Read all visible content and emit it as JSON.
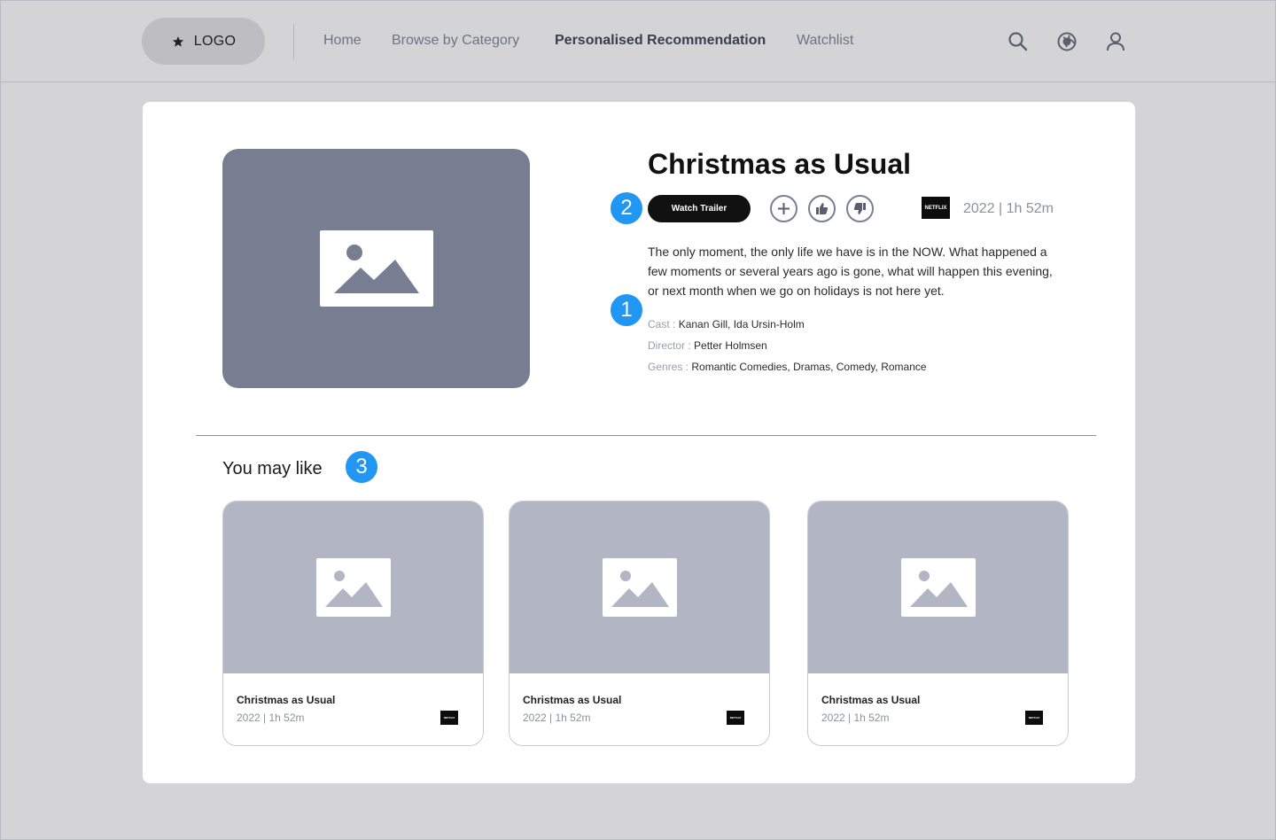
{
  "header": {
    "logo_text": "LOGO",
    "nav": [
      {
        "label": "Home",
        "active": false
      },
      {
        "label": "Browse by Category",
        "active": false
      },
      {
        "label": "Personalised Recommendation",
        "active": true
      },
      {
        "label": "Watchlist",
        "active": false
      }
    ],
    "icons": [
      "search-icon",
      "globe-icon",
      "user-icon"
    ]
  },
  "detail": {
    "title": "Christmas as Usual",
    "trailer_label": "Watch Trailer",
    "actions": [
      "add-icon",
      "thumbs-up-icon",
      "thumbs-down-icon"
    ],
    "provider": "NETFLIX",
    "meta": "2022 | 1h 52m",
    "description": "The only moment, the only life we have is in the NOW. What happened a few moments or several years ago is gone, what will happen this evening, or next month when we go on holidays is not here yet.",
    "cast_label": "Cast : ",
    "cast": "Kanan Gill, Ida Ursin-Holm",
    "director_label": "Director : ",
    "director": "Petter Holmsen",
    "genres_label": "Genres : ",
    "genres": "Romantic Comedies, Dramas, Comedy, Romance"
  },
  "badges": [
    "1",
    "2",
    "3"
  ],
  "recommendations": {
    "heading": "You may like",
    "items": [
      {
        "title": "Christmas as Usual",
        "meta": "2022 | 1h 52m",
        "provider": "NETFLIX"
      },
      {
        "title": "Christmas as Usual",
        "meta": "2022 | 1h 52m",
        "provider": "NETFLIX"
      },
      {
        "title": "Christmas as Usual",
        "meta": "2022 | 1h 52m",
        "provider": "NETFLIX"
      }
    ]
  },
  "colors": {
    "badge": "#2196f3",
    "background": "#d4d4d6",
    "hero_placeholder": "#787e91",
    "thumb_placeholder": "#b1b5c4"
  }
}
